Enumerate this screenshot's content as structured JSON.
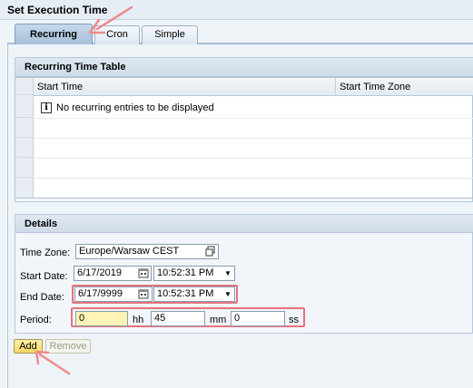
{
  "title": "Set Execution Time",
  "tabs": [
    {
      "label": "Recurring",
      "active": true
    },
    {
      "label": "Cron",
      "active": false
    },
    {
      "label": "Simple",
      "active": false
    }
  ],
  "recurring": {
    "header": "Recurring Time Table",
    "columns": [
      "Start Time",
      "Start Time Zone"
    ],
    "empty_message": "No recurring entries to be displayed"
  },
  "details": {
    "header": "Details",
    "time_zone": {
      "label": "Time Zone:",
      "value": "Europe/Warsaw CEST"
    },
    "start_date": {
      "label": "Start Date:",
      "date": "6/17/2019",
      "time": "10:52:31 PM"
    },
    "end_date": {
      "label": "End Date:",
      "date": "6/17/9999",
      "time": "10:52:31 PM"
    },
    "period": {
      "label": "Period:",
      "hh": "0",
      "hh_unit": "hh",
      "mm": "45",
      "mm_unit": "mm",
      "ss": "0",
      "ss_unit": "ss"
    }
  },
  "buttons": {
    "add": "Add",
    "remove": "Remove"
  },
  "colors": {
    "highlight": "#e8727a",
    "arrow": "#f08a8e",
    "required_field": "#fff4b5"
  }
}
